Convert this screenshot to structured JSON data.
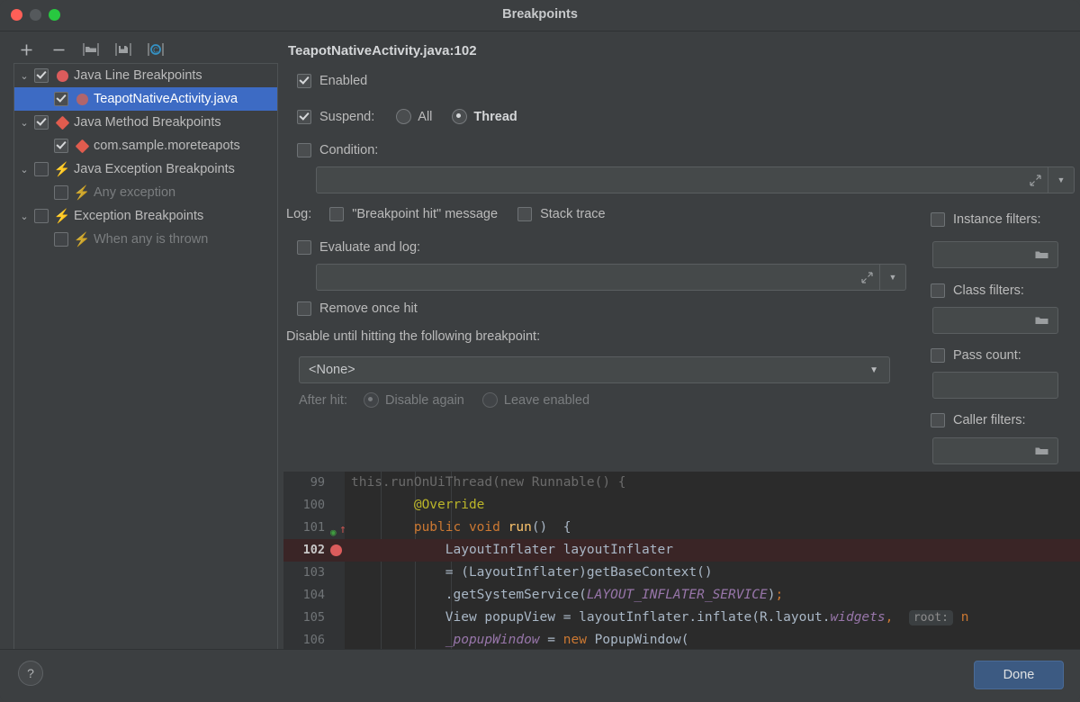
{
  "window": {
    "title": "Breakpoints",
    "traffic_lights": [
      "close-red",
      "minimize-gray",
      "zoom-green"
    ]
  },
  "toolbar": {
    "items": [
      {
        "name": "add-breakpoint",
        "glyph": "+"
      },
      {
        "name": "remove-breakpoint",
        "glyph": "−"
      },
      {
        "name": "group-by-folder",
        "glyph": "folder-icon"
      },
      {
        "name": "save-to-file",
        "glyph": "disk-icon"
      },
      {
        "name": "view-breakpoints-c",
        "glyph": "C"
      }
    ]
  },
  "tree": {
    "items": [
      {
        "label": "Java Line Breakpoints",
        "twisty": "⌄",
        "checked": true,
        "icon": "line-breakpoint",
        "level": 0,
        "selected": false,
        "dim": false
      },
      {
        "label": "TeapotNativeActivity.java",
        "twisty": "",
        "checked": true,
        "icon": "line-breakpoint-muted",
        "level": 1,
        "selected": true,
        "dim": false
      },
      {
        "label": "Java Method Breakpoints",
        "twisty": "⌄",
        "checked": true,
        "icon": "method-breakpoint",
        "level": 0,
        "selected": false,
        "dim": false
      },
      {
        "label": "com.sample.moreteapots",
        "twisty": "",
        "checked": true,
        "icon": "method-breakpoint",
        "level": 1,
        "selected": false,
        "dim": false
      },
      {
        "label": "Java Exception Breakpoints",
        "twisty": "⌄",
        "checked": false,
        "icon": "exception-breakpoint",
        "level": 0,
        "selected": false,
        "dim": false
      },
      {
        "label": "Any exception",
        "twisty": "",
        "checked": false,
        "icon": "exception-breakpoint-hollow",
        "level": 1,
        "selected": false,
        "dim": true
      },
      {
        "label": "Exception Breakpoints",
        "twisty": "⌄",
        "checked": false,
        "icon": "exception-breakpoint",
        "level": 0,
        "selected": false,
        "dim": false
      },
      {
        "label": "When any is thrown",
        "twisty": "",
        "checked": false,
        "icon": "exception-breakpoint-hollow",
        "level": 1,
        "selected": false,
        "dim": true
      }
    ]
  },
  "detail": {
    "title": "TeapotNativeActivity.java:102",
    "enabled": {
      "label": "Enabled",
      "checked": true
    },
    "suspend": {
      "label": "Suspend:",
      "checked": true,
      "options": [
        {
          "label": "All",
          "selected": false
        },
        {
          "label": "Thread",
          "selected": true
        }
      ]
    },
    "condition": {
      "label": "Condition:",
      "checked": false,
      "value": ""
    },
    "log": {
      "label": "Log:",
      "breakpoint_hit": {
        "label": "\"Breakpoint hit\" message",
        "checked": false
      },
      "stack_trace": {
        "label": "Stack trace",
        "checked": false
      }
    },
    "evaluate_and_log": {
      "label": "Evaluate and log:",
      "checked": false,
      "value": ""
    },
    "remove_once_hit": {
      "label": "Remove once hit",
      "checked": false
    },
    "disable_until": {
      "label": "Disable until hitting the following breakpoint:",
      "selected": "<None>"
    },
    "after_hit": {
      "label": "After hit:",
      "options": [
        {
          "label": "Disable again",
          "selected": true
        },
        {
          "label": "Leave enabled",
          "selected": false
        }
      ]
    },
    "filters": [
      {
        "label": "Instance filters:",
        "checked": false,
        "value": "",
        "has_browse": true
      },
      {
        "label": "Class filters:",
        "checked": false,
        "value": "",
        "has_browse": true
      },
      {
        "label": "Pass count:",
        "checked": false,
        "value": "",
        "has_browse": false
      },
      {
        "label": "Caller filters:",
        "checked": false,
        "value": "",
        "has_browse": true
      }
    ]
  },
  "bottom": {
    "help_label": "?",
    "done_label": "Done"
  },
  "editor": {
    "lines": [
      {
        "number": "99",
        "marker": "",
        "highlight": false
      },
      {
        "number": "100",
        "marker": "",
        "highlight": false
      },
      {
        "number": "101",
        "marker": "override",
        "highlight": false
      },
      {
        "number": "102",
        "marker": "breakpoint",
        "highlight": true
      },
      {
        "number": "103",
        "marker": "",
        "highlight": false
      },
      {
        "number": "104",
        "marker": "",
        "highlight": false
      },
      {
        "number": "105",
        "marker": "",
        "highlight": false
      },
      {
        "number": "106",
        "marker": "",
        "highlight": false
      }
    ],
    "code": [
      "this.runOnUiThread(new Runnable() {",
      "@Override",
      "public void run()  {",
      "LayoutInflater layoutInflater",
      "= (LayoutInflater)getBaseContext()",
      ".getSystemService(LAYOUT_INFLATER_SERVICE);",
      "View popupView = layoutInflater.inflate(R.layout.widgets,  root: null",
      "_popupWindow = new PopupWindow("
    ],
    "inlay_hint": "root:",
    "colors": {
      "background": "#2b2b2b",
      "gutter": "#313335",
      "highlight_line": "#3a2526",
      "keyword": "#cc7832",
      "annotation": "#bbb529",
      "method": "#ffc66d",
      "constant": "#9876aa",
      "text": "#a9b7c6"
    }
  },
  "colors": {
    "window_bg": "#3c3f41",
    "selection_blue": "#3d6bc4",
    "accent_button": "#3c5a82",
    "breakpoint_red": "#db5c5c",
    "method_red": "#e05c4e",
    "toolbar_teal": "#3592c4"
  }
}
